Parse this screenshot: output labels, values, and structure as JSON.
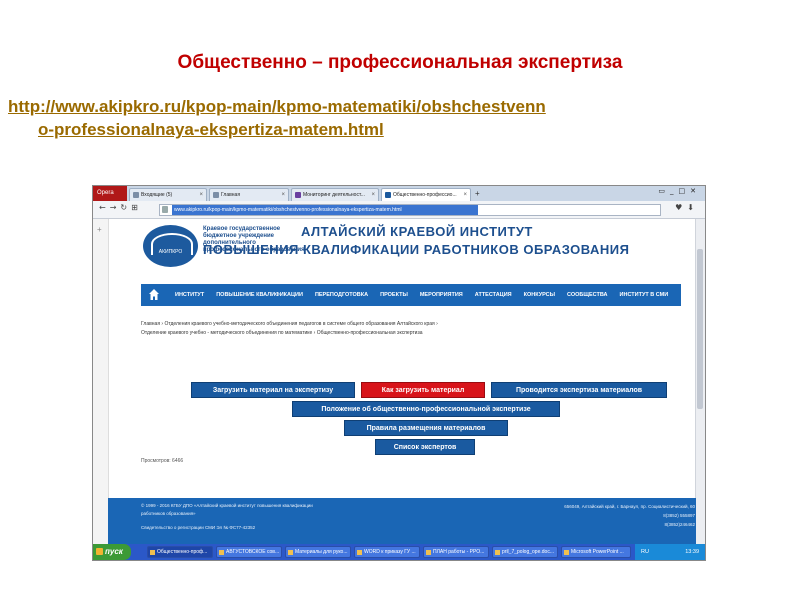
{
  "slide": {
    "title": "Общественно – профессиональная экспертиза",
    "url_line1": "http://www.akipkro.ru/kpop-main/kpmo-matematiki/obshchestvenn",
    "url_line2": "o-professionalnaya-ekspertiza-matem.html"
  },
  "browser": {
    "opera_label": "Opera",
    "tabs": [
      {
        "label": "Входящие (5)"
      },
      {
        "label": "Главная"
      },
      {
        "label": "Мониторинг деятельност..."
      },
      {
        "label": "Общественно-профессио..."
      }
    ],
    "address": "www.akipkro.ru/kpop-main/kpmo-matematiki/obshchestvenno-professionalnaya-ekspertiza-matem.html"
  },
  "site": {
    "org_small": "Краевое государственное бюджетное учреждение дополнительного профессионального образования",
    "logo_text": "АКИПКРО",
    "title_line1": "АЛТАЙСКИЙ КРАЕВОЙ ИНСТИТУТ",
    "title_line2": "ПОВЫШЕНИЯ КВАЛИФИКАЦИИ РАБОТНИКОВ ОБРАЗОВАНИЯ",
    "nav": [
      "ИНСТИТУТ",
      "ПОВЫШЕНИЕ КВАЛИФИКАЦИИ",
      "ПЕРЕПОДГОТОВКА",
      "ПРОЕКТЫ",
      "МЕРОПРИЯТИЯ",
      "АТТЕСТАЦИЯ",
      "КОНКУРСЫ",
      "СООБЩЕСТВА",
      "ИНСТИТУТ В СМИ"
    ],
    "breadcrumb_line1": "Главная  ›  Отделения краевого учебно-методического объединения педагогов в системе общего образования Алтайского края  ›",
    "breadcrumb_line2": "Отделение краевого учебно - методического объединения по математике  ›  Общественно-профессиональная экспертиза",
    "buttons": {
      "upload": "Загрузить материал на экспертизу",
      "how_upload": "Как загрузить материал",
      "in_progress": "Проводится экспертиза материалов",
      "regulation": "Положение об общественно-профессиональной экспертизе",
      "rules": "Правила размещения материалов",
      "experts": "Список экспертов"
    },
    "views": "Просмотров: 6466",
    "footer_left_1": "© 1999 - 2016  КГБУ ДПО «Алтайский краевой институт повышения квалификации",
    "footer_left_2": "работников образования»",
    "footer_left_3": "Свидетельство о регистрации СМИ Эл № ФС77-42352",
    "footer_right_1": "656049, Алтайский край, г. Барнаул, пр. Социалистический, 60",
    "footer_right_2": "8(3852) 555897",
    "footer_right_3": "8(3852)246462"
  },
  "taskbar": {
    "start": "пуск",
    "items": [
      "Общественно-проф...",
      "АВГУСТОВСКОЕ сов...",
      "Материалы для руко...",
      "WORD к приказу ГУ ...",
      "ПЛАН работы - PPO...",
      "pril_7_polog_ope.doc...",
      "Microsoft PowerPoint ..."
    ],
    "lang": "RU",
    "time": "13:39"
  },
  "colors": {
    "title_red": "#c00000",
    "url_gold": "#9a6a00",
    "site_blue": "#1a66b5",
    "button_red": "#d8141a"
  }
}
